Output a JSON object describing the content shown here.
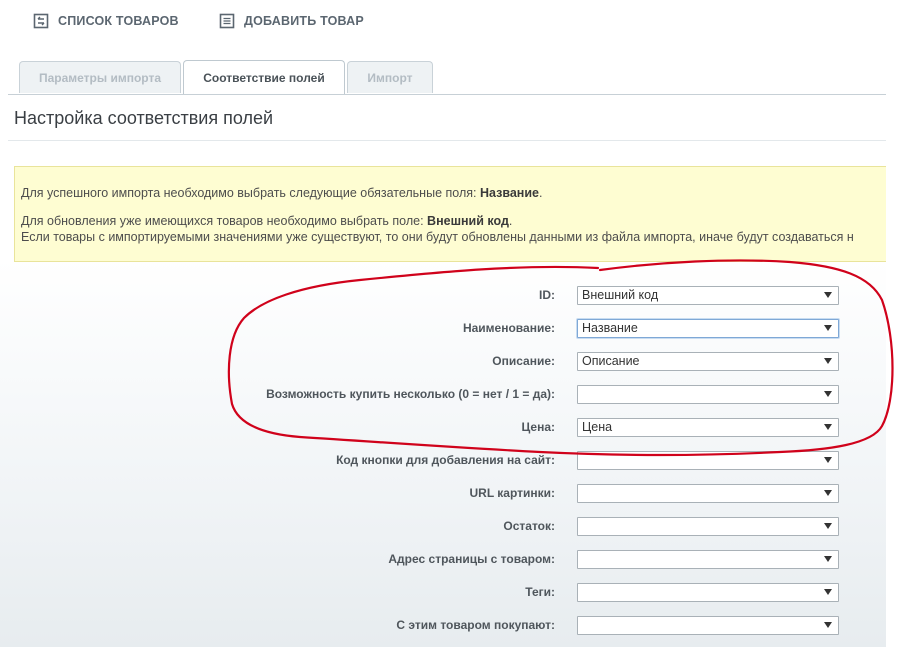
{
  "toolbar": {
    "list_label": "СПИСОК ТОВАРОВ",
    "add_label": "ДОБАВИТЬ ТОВАР"
  },
  "tabs": [
    {
      "label": "Параметры импорта",
      "active": false
    },
    {
      "label": "Соответствие полей",
      "active": true
    },
    {
      "label": "Импорт",
      "active": false
    }
  ],
  "page_title": "Настройка соответствия полей",
  "notice": {
    "line1_text": "Для успешного импорта необходимо выбрать следующие обязательные поля: ",
    "line1_bold": "Название",
    "line1_end": ".",
    "line2_text": "Для обновления уже имеющихся товаров необходимо выбрать поле: ",
    "line2_bold": "Внешний код",
    "line2_end": ".",
    "line3_text": "Если товары с импортируемыми значениями уже существуют, то они будут обновлены данными из файла импорта, иначе будут создаваться н"
  },
  "fields": [
    {
      "label": "ID:",
      "value": "Внешний код"
    },
    {
      "label": "Наименование:",
      "value": "Название"
    },
    {
      "label": "Описание:",
      "value": "Описание"
    },
    {
      "label": "Возможность купить несколько (0 = нет / 1 = да):",
      "value": ""
    },
    {
      "label": "Цена:",
      "value": "Цена"
    },
    {
      "label": "Код кнопки для добавления на сайт:",
      "value": ""
    },
    {
      "label": "URL картинки:",
      "value": ""
    },
    {
      "label": "Остаток:",
      "value": ""
    },
    {
      "label": "Адрес страницы с товаром:",
      "value": ""
    },
    {
      "label": "Теги:",
      "value": ""
    },
    {
      "label": "С этим товаром покупают:",
      "value": ""
    }
  ],
  "colors": {
    "annotation_stroke": "#d0021b",
    "notice_background": "#fefdd2"
  }
}
